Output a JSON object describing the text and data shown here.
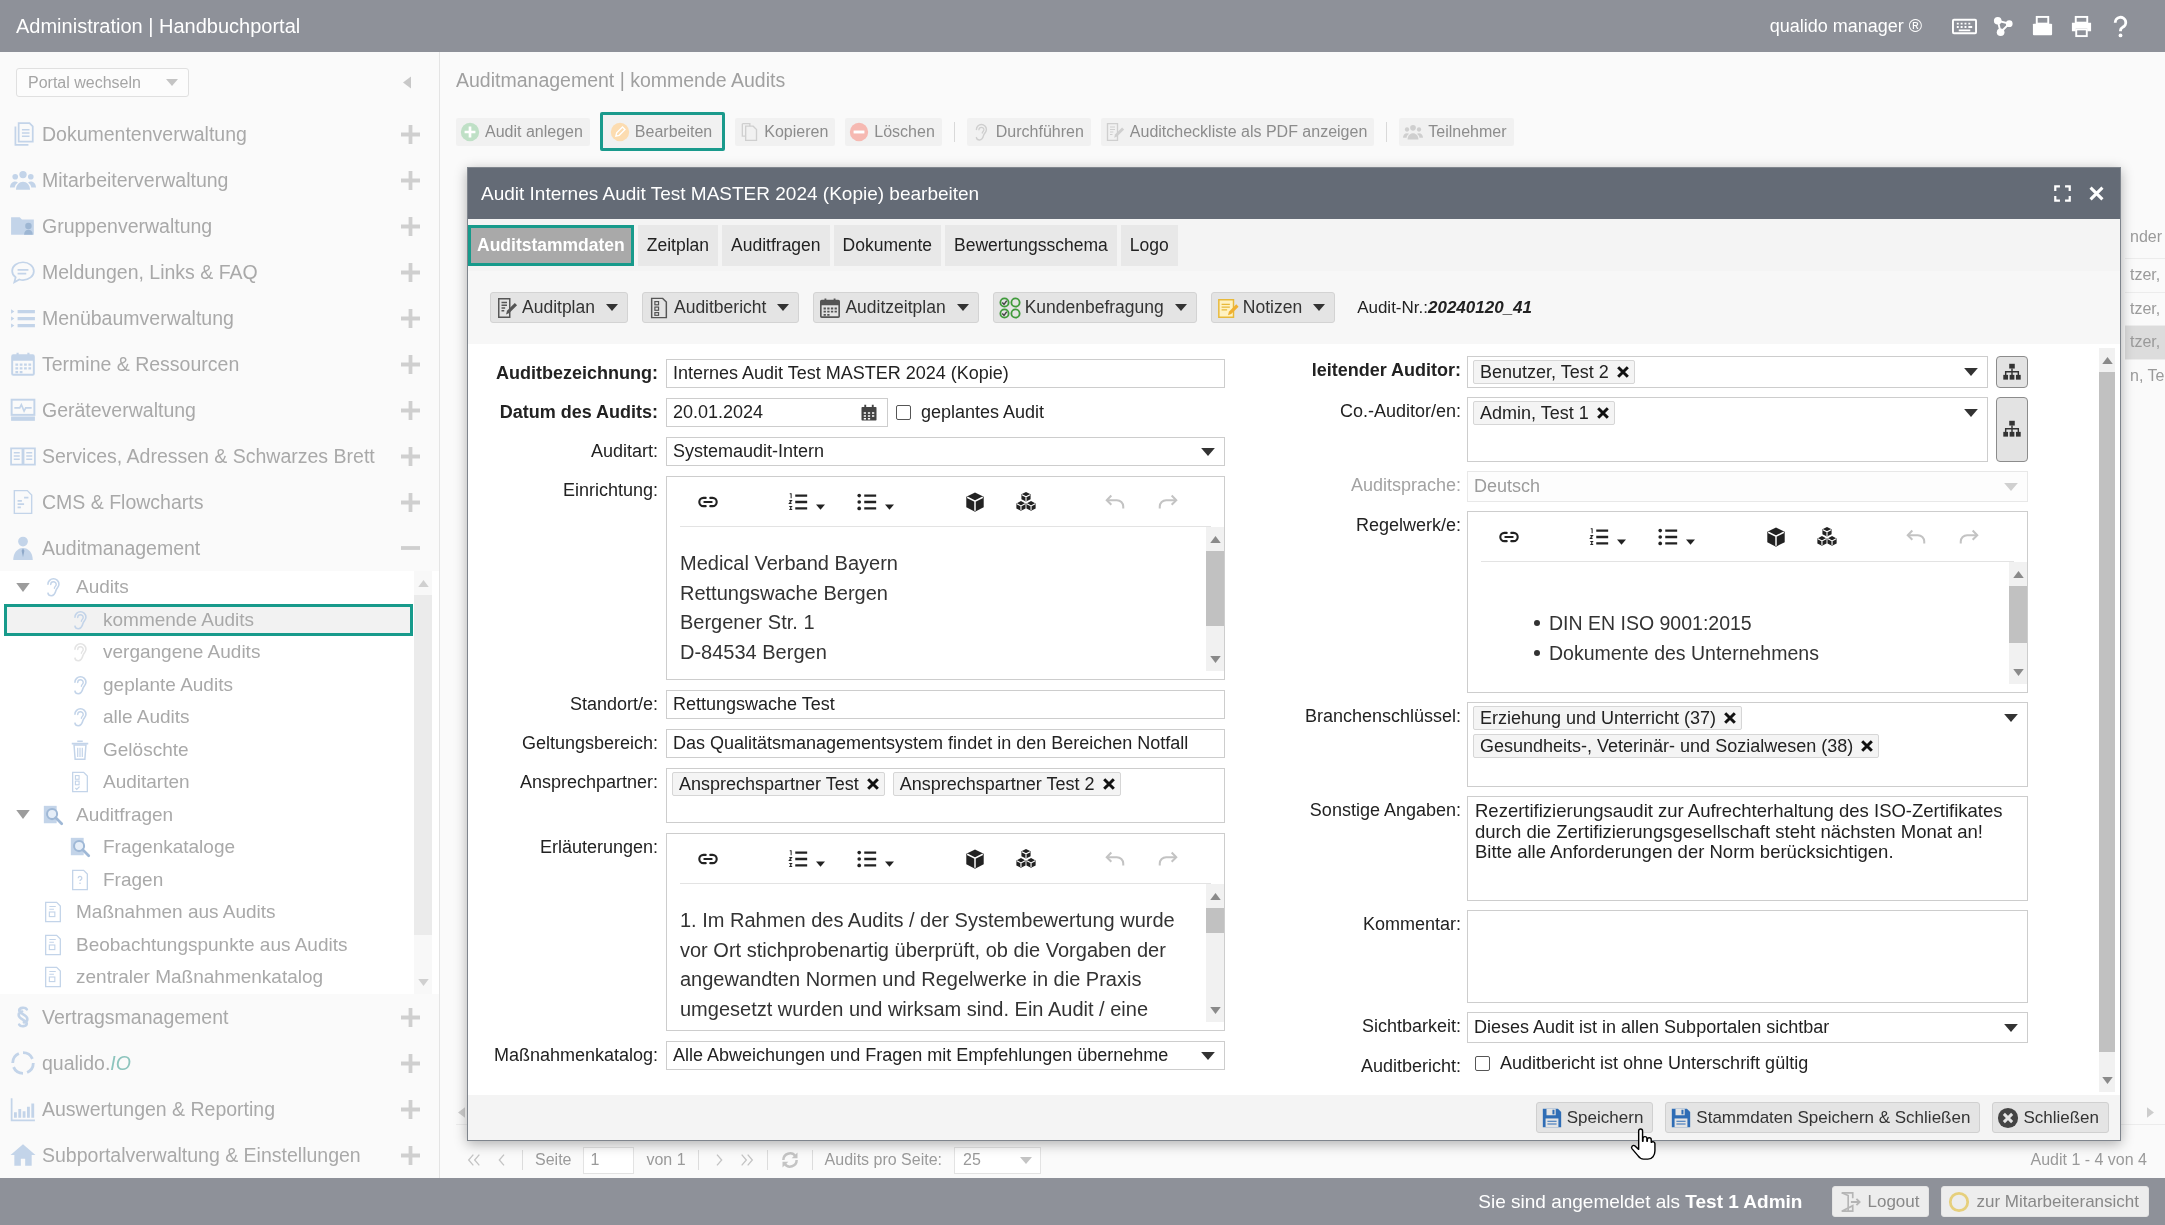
{
  "app_bar": {
    "title": "Administration | Handbuchportal",
    "product": "qualido manager ®"
  },
  "sidebar": {
    "portal_switch": "Portal wechseln",
    "sections": [
      {
        "label": "Dokumentenverwaltung",
        "expanded": false
      },
      {
        "label": "Mitarbeiterverwaltung",
        "expanded": false
      },
      {
        "label": "Gruppenverwaltung",
        "expanded": false
      },
      {
        "label": "Meldungen, Links & FAQ",
        "expanded": false
      },
      {
        "label": "Menübaumverwaltung",
        "expanded": false
      },
      {
        "label": "Termine & Ressourcen",
        "expanded": false
      },
      {
        "label": "Geräteverwaltung",
        "expanded": false
      },
      {
        "label": "Services, Adressen & Schwarzes Brett",
        "expanded": false
      },
      {
        "label": "CMS & Flowcharts",
        "expanded": false
      },
      {
        "label": "Auditmanagement",
        "expanded": true,
        "children": [
          {
            "label": "Audits",
            "expanded": true,
            "selected": false,
            "children": [
              {
                "label": "kommende Audits",
                "selected": true
              },
              {
                "label": "vergangene Audits",
                "selected": false
              },
              {
                "label": "geplante Audits",
                "selected": false
              },
              {
                "label": "alle Audits",
                "selected": false
              },
              {
                "label": "Gelöschte",
                "selected": false
              },
              {
                "label": "Auditarten",
                "selected": false
              }
            ]
          },
          {
            "label": "Auditfragen",
            "expanded": true,
            "selected": false,
            "children": [
              {
                "label": "Fragenkataloge",
                "selected": false
              },
              {
                "label": "Fragen",
                "selected": false
              }
            ]
          },
          {
            "label": "Maßnahmen aus Audits",
            "selected": false
          },
          {
            "label": "Beobachtungspunkte aus Audits",
            "selected": false
          },
          {
            "label": "zentraler Maßnahmenkatalog",
            "selected": false
          }
        ]
      },
      {
        "label": "Vertragsmanagement",
        "expanded": false
      },
      {
        "label": "qualido.*IO*",
        "expanded": false
      },
      {
        "label": "Auswertungen & Reporting",
        "expanded": false
      },
      {
        "label": "Subportalverwaltung & Einstellungen",
        "expanded": false
      }
    ]
  },
  "page": {
    "breadcrumb": "Auditmanagement | kommende Audits",
    "toolbar": [
      {
        "buttons": [
          {
            "label": "Audit anlegen",
            "highlighted": false
          },
          {
            "label": "Bearbeiten",
            "highlighted": true
          },
          {
            "label": "Kopieren",
            "highlighted": false
          },
          {
            "label": "Löschen",
            "highlighted": false
          }
        ]
      },
      {
        "buttons": [
          {
            "label": "Durchführen",
            "highlighted": false
          },
          {
            "label": "Auditcheckliste als PDF anzeigen",
            "highlighted": false
          }
        ]
      },
      {
        "buttons": [
          {
            "label": "Teilnehmer",
            "highlighted": false
          }
        ]
      }
    ],
    "table": {
      "columns": [
        {
          "label": "nder"
        }
      ],
      "rows": [
        {
          "column_1": "tzer,",
          "selected": false
        },
        {
          "column_1": "tzer,",
          "selected": false
        },
        {
          "column_1": "tzer,",
          "selected": true
        },
        {
          "column_1": "n, Te",
          "selected": false
        }
      ]
    },
    "pagination": {
      "page_label": "Seite",
      "page": "1",
      "page_count": "von 1",
      "per_page_label": "Audits pro Seite:",
      "per_page": "25",
      "summary": "Audit 1 - 4 von 4"
    }
  },
  "dialog": {
    "title": "Audit Internes Audit Test MASTER 2024 (Kopie) bearbeiten",
    "tabs": [
      {
        "label": "Auditstammdaten",
        "selected": true
      },
      {
        "label": "Zeitplan",
        "selected": false
      },
      {
        "label": "Auditfragen",
        "selected": false
      },
      {
        "label": "Dokumente",
        "selected": false
      },
      {
        "label": "Bewertungsschema",
        "selected": false
      },
      {
        "label": "Logo",
        "selected": false
      }
    ],
    "actions": [
      {
        "label": "Auditplan"
      },
      {
        "label": "Auditbericht"
      },
      {
        "label": "Auditzeitplan"
      },
      {
        "label": "Kundenbefragung"
      },
      {
        "label": "Notizen"
      }
    ],
    "audit_number": {
      "label": "Audit-Nr.:",
      "value": "20240120_41"
    },
    "left_fields": [
      {
        "kind": "text",
        "label": "Auditbezeichnung:",
        "required": true,
        "disabled": false,
        "value": "Internes Audit Test MASTER 2024 (Kopie)"
      },
      {
        "kind": "date",
        "label": "Datum des Audits:",
        "required": true,
        "disabled": false,
        "value": "20.01.2024",
        "option": {
          "label": "geplantes Audit",
          "checked": false
        }
      },
      {
        "kind": "select",
        "label": "Auditart:",
        "required": false,
        "disabled": false,
        "value": "Systemaudit-Intern"
      },
      {
        "kind": "editor",
        "label": "Einrichtung:",
        "required": false,
        "disabled": false,
        "text": "Medical Verband Bayern\nRettungswache Bergen\nBergener Str. 1\nD-84534 Bergen"
      },
      {
        "kind": "text",
        "label": "Standort/e:",
        "required": false,
        "disabled": false,
        "value": "Rettungswache Test"
      },
      {
        "kind": "text",
        "label": "Geltungsbereich:",
        "required": false,
        "disabled": false,
        "value": "Das Qualitätsmanagementsystem findet in den Bereichen Notfall"
      },
      {
        "kind": "tags",
        "label": "Ansprechpartner:",
        "required": false,
        "disabled": false,
        "tags": [
          "Ansprechspartner Test",
          "Ansprechspartner Test 2"
        ]
      },
      {
        "kind": "editor",
        "label": "Erläuterungen:",
        "required": false,
        "disabled": false,
        "text": "1. Im Rahmen des Audits / der Systembewertung wurde vor Ort stichprobenartig überprüft, ob die Vorgaben der angewandten Normen und Regelwerke in die Praxis umgesetzt wurden und wirksam sind. Ein Audit / eine"
      },
      {
        "kind": "select",
        "label": "Maßnahmenkatalog:",
        "required": false,
        "disabled": false,
        "value": "Alle Abweichungen und Fragen mit Empfehlungen übernehme"
      }
    ],
    "right_fields": [
      {
        "kind": "tagselect",
        "label": "leitender Auditor:",
        "required": true,
        "disabled": false,
        "picker": true,
        "tags": [
          "Benutzer, Test 2"
        ]
      },
      {
        "kind": "tagselect",
        "label": "Co.-Auditor/en:",
        "required": false,
        "disabled": false,
        "picker": true,
        "tags": [
          "Admin, Test 1"
        ]
      },
      {
        "kind": "select",
        "label": "Auditsprache:",
        "required": false,
        "disabled": true,
        "value": "Deutsch"
      },
      {
        "kind": "editor",
        "label": "Regelwerk/e:",
        "required": false,
        "disabled": false,
        "items": [
          "DIN EN ISO 9001:2015",
          "Dokumente des Unternehmens"
        ]
      },
      {
        "kind": "tagselect",
        "label": "Branchenschlüssel:",
        "required": false,
        "disabled": false,
        "picker": false,
        "tags": [
          "Erziehung und Unterricht (37)",
          "Gesundheits-, Veterinär- und Sozialwesen (38)"
        ]
      },
      {
        "kind": "textarea",
        "label": "Sonstige Angaben:",
        "required": false,
        "disabled": false,
        "value": "Rezertifizierungsaudit zur Aufrechterhaltung des ISO-Zertifikates durch die Zertifizierungsgesellschaft steht nächsten Monat an!\nBitte alle Anforderungen der Norm berücksichtigen."
      },
      {
        "kind": "textarea",
        "label": "Kommentar:",
        "required": false,
        "disabled": false
      },
      {
        "kind": "select",
        "label": "Sichtbarkeit:",
        "required": false,
        "disabled": false,
        "value": "Dieses Audit ist in allen Subportalen sichtbar"
      },
      {
        "kind": "checkbox",
        "label": "Auditbericht:",
        "required": false,
        "disabled": false,
        "text": "Auditbericht ist ohne Unterschrift gültig",
        "checked": false
      }
    ],
    "buttons": [
      {
        "label": "Speichern"
      },
      {
        "label": "Stammdaten Speichern & Schließen"
      },
      {
        "label": "Schließen"
      }
    ]
  },
  "status_bar": {
    "login_text": "Sie sind angemeldet als **Test 1 Admin**",
    "buttons": [
      {
        "label": "Logout"
      },
      {
        "label": "zur Mitarbeiteransicht"
      }
    ]
  }
}
